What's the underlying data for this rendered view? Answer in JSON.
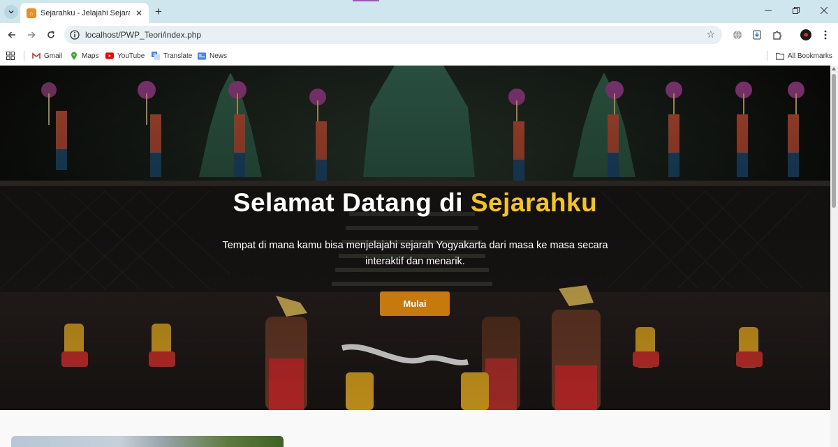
{
  "browser": {
    "tab": {
      "title": "Sejarahku - Jelajahi Sejarah Indo",
      "favicon": "sejarahku-favicon"
    },
    "address": {
      "url": "localhost/PWP_Teori/index.php"
    },
    "bookmarks": [
      {
        "label": "Gmail",
        "icon": "gmail-icon"
      },
      {
        "label": "Maps",
        "icon": "maps-icon"
      },
      {
        "label": "YouTube",
        "icon": "youtube-icon"
      },
      {
        "label": "Translate",
        "icon": "translate-icon"
      },
      {
        "label": "News",
        "icon": "news-icon"
      }
    ],
    "all_bookmarks": "All Bookmarks"
  },
  "hero": {
    "title_prefix": "Selamat Datang di ",
    "title_accent": "Sejarahku",
    "description": "Tempat di mana kamu bisa menjelajahi sejarah Yogyakarta dari masa ke masa secara interaktif dan menarik.",
    "button_label": "Mulai",
    "accent_color": "#f5c518",
    "button_color": "#c8790d"
  }
}
